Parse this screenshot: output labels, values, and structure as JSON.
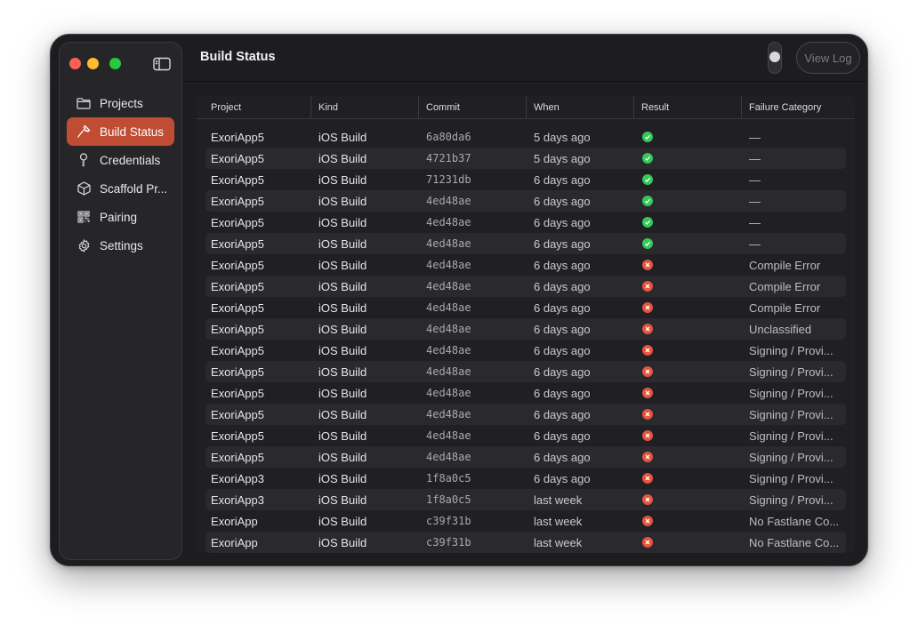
{
  "window": {
    "title": "Build Status"
  },
  "sidebar": {
    "items": [
      {
        "label": "Projects",
        "icon": "folder-icon",
        "active": false
      },
      {
        "label": "Build Status",
        "icon": "hammer-icon",
        "active": true
      },
      {
        "label": "Credentials",
        "icon": "key-icon",
        "active": false
      },
      {
        "label": "Scaffold Pr...",
        "icon": "cube-icon",
        "active": false
      },
      {
        "label": "Pairing",
        "icon": "qrcode-icon",
        "active": false
      },
      {
        "label": "Settings",
        "icon": "gear-icon",
        "active": false
      }
    ]
  },
  "toolbar": {
    "view_log_label": "View Log"
  },
  "colors": {
    "accent": "#bf4c33",
    "success": "#34c759",
    "failure": "#e5533d"
  },
  "table": {
    "columns": [
      "Project",
      "Kind",
      "Commit",
      "When",
      "Result",
      "Failure Category"
    ],
    "rows": [
      {
        "project": "ExoriApp5",
        "kind": "iOS Build",
        "commit": "6a80da6",
        "when": "5 days ago",
        "result": "success",
        "failure": "—"
      },
      {
        "project": "ExoriApp5",
        "kind": "iOS Build",
        "commit": "4721b37",
        "when": "5 days ago",
        "result": "success",
        "failure": "—"
      },
      {
        "project": "ExoriApp5",
        "kind": "iOS Build",
        "commit": "71231db",
        "when": "6 days ago",
        "result": "success",
        "failure": "—"
      },
      {
        "project": "ExoriApp5",
        "kind": "iOS Build",
        "commit": "4ed48ae",
        "when": "6 days ago",
        "result": "success",
        "failure": "—"
      },
      {
        "project": "ExoriApp5",
        "kind": "iOS Build",
        "commit": "4ed48ae",
        "when": "6 days ago",
        "result": "success",
        "failure": "—"
      },
      {
        "project": "ExoriApp5",
        "kind": "iOS Build",
        "commit": "4ed48ae",
        "when": "6 days ago",
        "result": "success",
        "failure": "—"
      },
      {
        "project": "ExoriApp5",
        "kind": "iOS Build",
        "commit": "4ed48ae",
        "when": "6 days ago",
        "result": "failure",
        "failure": "Compile Error"
      },
      {
        "project": "ExoriApp5",
        "kind": "iOS Build",
        "commit": "4ed48ae",
        "when": "6 days ago",
        "result": "failure",
        "failure": "Compile Error"
      },
      {
        "project": "ExoriApp5",
        "kind": "iOS Build",
        "commit": "4ed48ae",
        "when": "6 days ago",
        "result": "failure",
        "failure": "Compile Error"
      },
      {
        "project": "ExoriApp5",
        "kind": "iOS Build",
        "commit": "4ed48ae",
        "when": "6 days ago",
        "result": "failure",
        "failure": "Unclassified"
      },
      {
        "project": "ExoriApp5",
        "kind": "iOS Build",
        "commit": "4ed48ae",
        "when": "6 days ago",
        "result": "failure",
        "failure": "Signing / Provi..."
      },
      {
        "project": "ExoriApp5",
        "kind": "iOS Build",
        "commit": "4ed48ae",
        "when": "6 days ago",
        "result": "failure",
        "failure": "Signing / Provi..."
      },
      {
        "project": "ExoriApp5",
        "kind": "iOS Build",
        "commit": "4ed48ae",
        "when": "6 days ago",
        "result": "failure",
        "failure": "Signing / Provi..."
      },
      {
        "project": "ExoriApp5",
        "kind": "iOS Build",
        "commit": "4ed48ae",
        "when": "6 days ago",
        "result": "failure",
        "failure": "Signing / Provi..."
      },
      {
        "project": "ExoriApp5",
        "kind": "iOS Build",
        "commit": "4ed48ae",
        "when": "6 days ago",
        "result": "failure",
        "failure": "Signing / Provi..."
      },
      {
        "project": "ExoriApp5",
        "kind": "iOS Build",
        "commit": "4ed48ae",
        "when": "6 days ago",
        "result": "failure",
        "failure": "Signing / Provi..."
      },
      {
        "project": "ExoriApp3",
        "kind": "iOS Build",
        "commit": "1f8a0c5",
        "when": "6 days ago",
        "result": "failure",
        "failure": "Signing / Provi..."
      },
      {
        "project": "ExoriApp3",
        "kind": "iOS Build",
        "commit": "1f8a0c5",
        "when": "last week",
        "result": "failure",
        "failure": "Signing / Provi..."
      },
      {
        "project": "ExoriApp",
        "kind": "iOS Build",
        "commit": "c39f31b",
        "when": "last week",
        "result": "failure",
        "failure": "No Fastlane Co..."
      },
      {
        "project": "ExoriApp",
        "kind": "iOS Build",
        "commit": "c39f31b",
        "when": "last week",
        "result": "failure",
        "failure": "No Fastlane Co..."
      }
    ]
  }
}
